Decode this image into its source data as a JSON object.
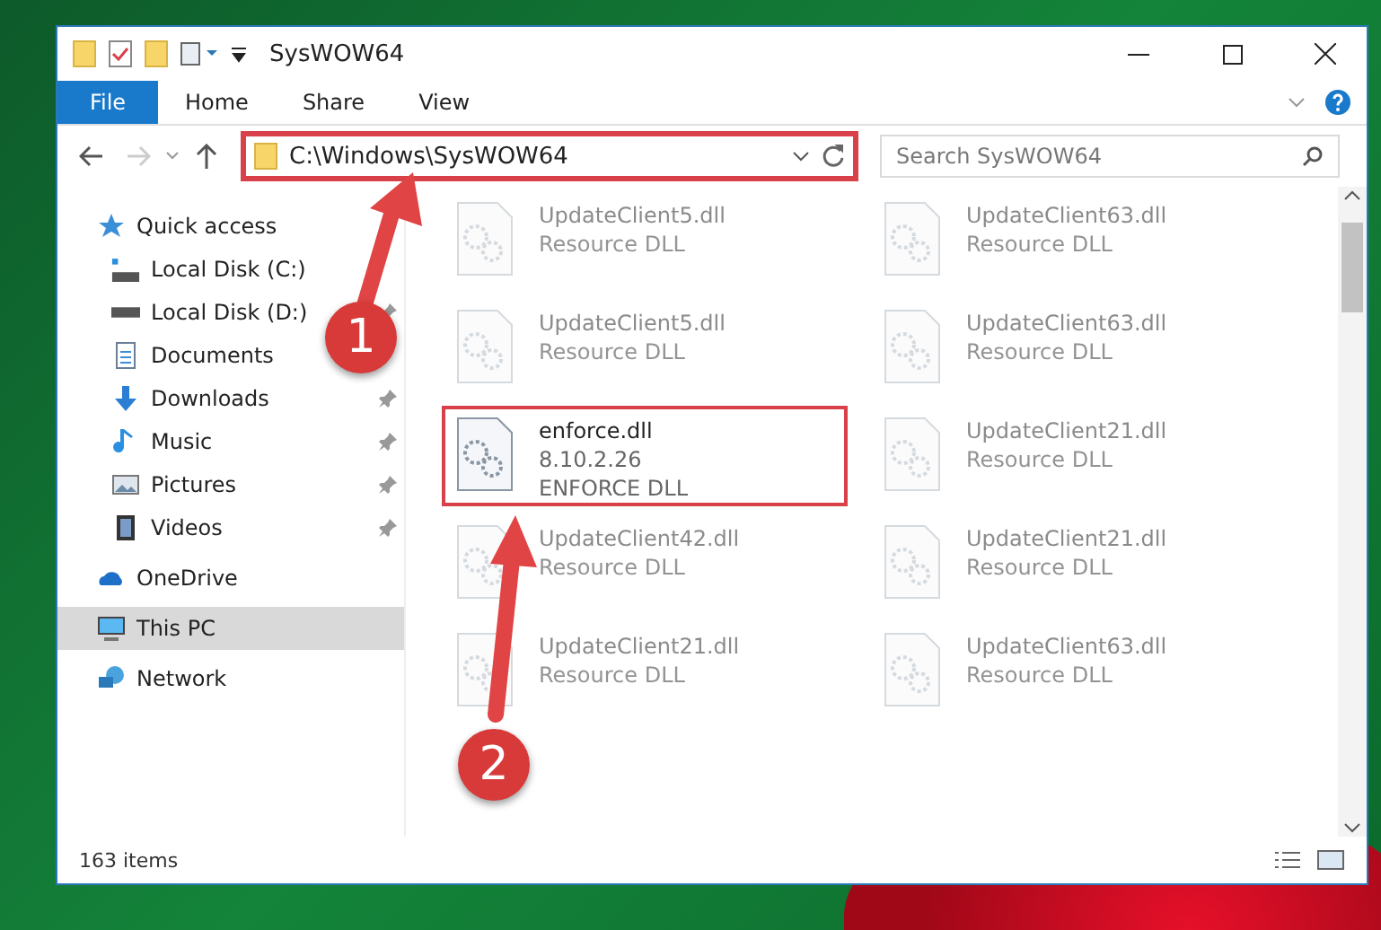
{
  "window": {
    "title": "SysWOW64"
  },
  "ribbon_tabs": [
    {
      "label": "File",
      "selected": true
    },
    {
      "label": "Home",
      "selected": false
    },
    {
      "label": "Share",
      "selected": false
    },
    {
      "label": "View",
      "selected": false
    }
  ],
  "address_bar": {
    "value": "C:\\Windows\\SysWOW64",
    "highlighted": true
  },
  "search": {
    "placeholder": "Search SysWOW64"
  },
  "sidebar": {
    "items": [
      {
        "label": "Quick access",
        "kind": "star",
        "selected": false,
        "children": [
          {
            "label": "Local Disk (C:)",
            "kind": "system",
            "selected": false,
            "pinned": false
          },
          {
            "label": "Local Disk (D:)",
            "kind": "drive",
            "selected": false,
            "pinned": true
          },
          {
            "label": "Documents",
            "kind": "document",
            "selected": false,
            "pinned": false
          },
          {
            "label": "Downloads",
            "kind": "download",
            "selected": false,
            "pinned": true
          },
          {
            "label": "Music",
            "kind": "music",
            "selected": false,
            "pinned": true
          },
          {
            "label": "Pictures",
            "kind": "picture",
            "selected": false,
            "pinned": true
          },
          {
            "label": "Videos",
            "kind": "video",
            "selected": false,
            "pinned": true
          }
        ]
      },
      {
        "label": "OneDrive",
        "kind": "cloud",
        "selected": false
      },
      {
        "label": "This PC",
        "kind": "computer",
        "selected": true
      },
      {
        "label": "Network",
        "kind": "network",
        "selected": false
      }
    ]
  },
  "files": [
    {
      "name": "UpdateClient5.dll",
      "lines": [
        "Resource DLL"
      ],
      "highlighted": false
    },
    {
      "name": "UpdateClient63.dll",
      "lines": [
        "Resource DLL"
      ],
      "highlighted": false
    },
    {
      "name": "UpdateClient5.dll",
      "lines": [
        "Resource DLL"
      ],
      "highlighted": false
    },
    {
      "name": "UpdateClient63.dll",
      "lines": [
        "Resource DLL"
      ],
      "highlighted": false
    },
    {
      "name": "enforce.dll",
      "lines": [
        "8.10.2.26",
        "ENFORCE DLL"
      ],
      "highlighted": true
    },
    {
      "name": "UpdateClient21.dll",
      "lines": [
        "Resource DLL"
      ],
      "highlighted": false
    },
    {
      "name": "UpdateClient42.dll",
      "lines": [
        "Resource DLL"
      ],
      "highlighted": false
    },
    {
      "name": "UpdateClient21.dll",
      "lines": [
        "Resource DLL"
      ],
      "highlighted": false
    },
    {
      "name": "UpdateClient21.dll",
      "lines": [
        "Resource DLL"
      ],
      "highlighted": false
    },
    {
      "name": "UpdateClient63.dll",
      "lines": [
        "Resource DLL"
      ],
      "highlighted": false
    }
  ],
  "status_bar": {
    "item_count": "163 items"
  },
  "callouts": [
    {
      "number": "1"
    },
    {
      "number": "2"
    }
  ]
}
